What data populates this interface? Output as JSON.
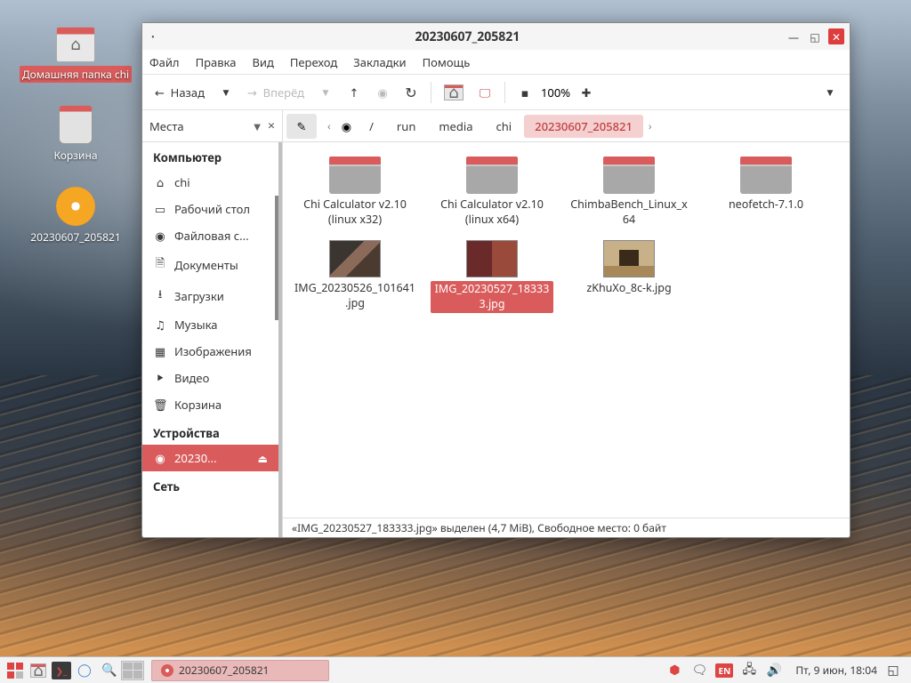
{
  "desktop": {
    "icons": [
      {
        "name": "home-folder",
        "label": "Домашняя папка chi",
        "selected": true,
        "kind": "folder-home"
      },
      {
        "name": "trash",
        "label": "Корзина",
        "selected": false,
        "kind": "trash"
      },
      {
        "name": "mounted-disc",
        "label": "20230607_205821",
        "selected": false,
        "kind": "disc"
      }
    ]
  },
  "window": {
    "title": "20230607_205821",
    "menu": [
      "Файл",
      "Правка",
      "Вид",
      "Переход",
      "Закладки",
      "Помощь"
    ],
    "toolbar": {
      "back": "Назад",
      "forward": "Вперёд",
      "zoom": "100%"
    },
    "sidebar": {
      "places_label": "Места",
      "sections": {
        "computer": "Компьютер",
        "devices": "Устройства",
        "network": "Сеть"
      },
      "computer_items": [
        {
          "icon": "⌂",
          "label": "chi",
          "name": "home"
        },
        {
          "icon": "▭",
          "label": "Рабочий стол",
          "name": "desktop"
        },
        {
          "icon": "◉",
          "label": "Файловая с...",
          "name": "filesystem"
        },
        {
          "icon": "🗎",
          "label": "Документы",
          "name": "documents"
        },
        {
          "icon": "⭳",
          "label": "Загрузки",
          "name": "downloads"
        },
        {
          "icon": "♫",
          "label": "Музыка",
          "name": "music"
        },
        {
          "icon": "▦",
          "label": "Изображения",
          "name": "pictures"
        },
        {
          "icon": "⯈",
          "label": "Видео",
          "name": "videos"
        },
        {
          "icon": "🗑",
          "label": "Корзина",
          "name": "trash"
        }
      ],
      "device_active": {
        "label": "20230..."
      }
    },
    "path": {
      "segments": [
        {
          "label": "/",
          "icon": "◉"
        },
        {
          "label": "run"
        },
        {
          "label": "media"
        },
        {
          "label": "chi"
        },
        {
          "label": "20230607_205821",
          "current": true
        }
      ]
    },
    "files": [
      {
        "name": "Chi Calculator v2.10 (linux x32)",
        "kind": "folder"
      },
      {
        "name": "Chi Calculator v2.10 (linux x64)",
        "kind": "folder"
      },
      {
        "name": "ChimbaBench_Linux_x64",
        "kind": "folder"
      },
      {
        "name": "neofetch-7.1.0",
        "kind": "folder"
      },
      {
        "name": "IMG_20230526_101641.jpg",
        "kind": "image",
        "thumb": "p1"
      },
      {
        "name": "IMG_20230527_183333.jpg",
        "kind": "image",
        "thumb": "p2",
        "selected": true
      },
      {
        "name": "zKhuXo_8c-k.jpg",
        "kind": "image",
        "thumb": "p3"
      }
    ],
    "status": "«IMG_20230527_183333.jpg» выделен (4,7 MiB), Свободное место: 0 байт"
  },
  "taskbar": {
    "active_window": "20230607_205821",
    "lang": "EN",
    "clock": "Пт,  9 июн, 18:04"
  }
}
